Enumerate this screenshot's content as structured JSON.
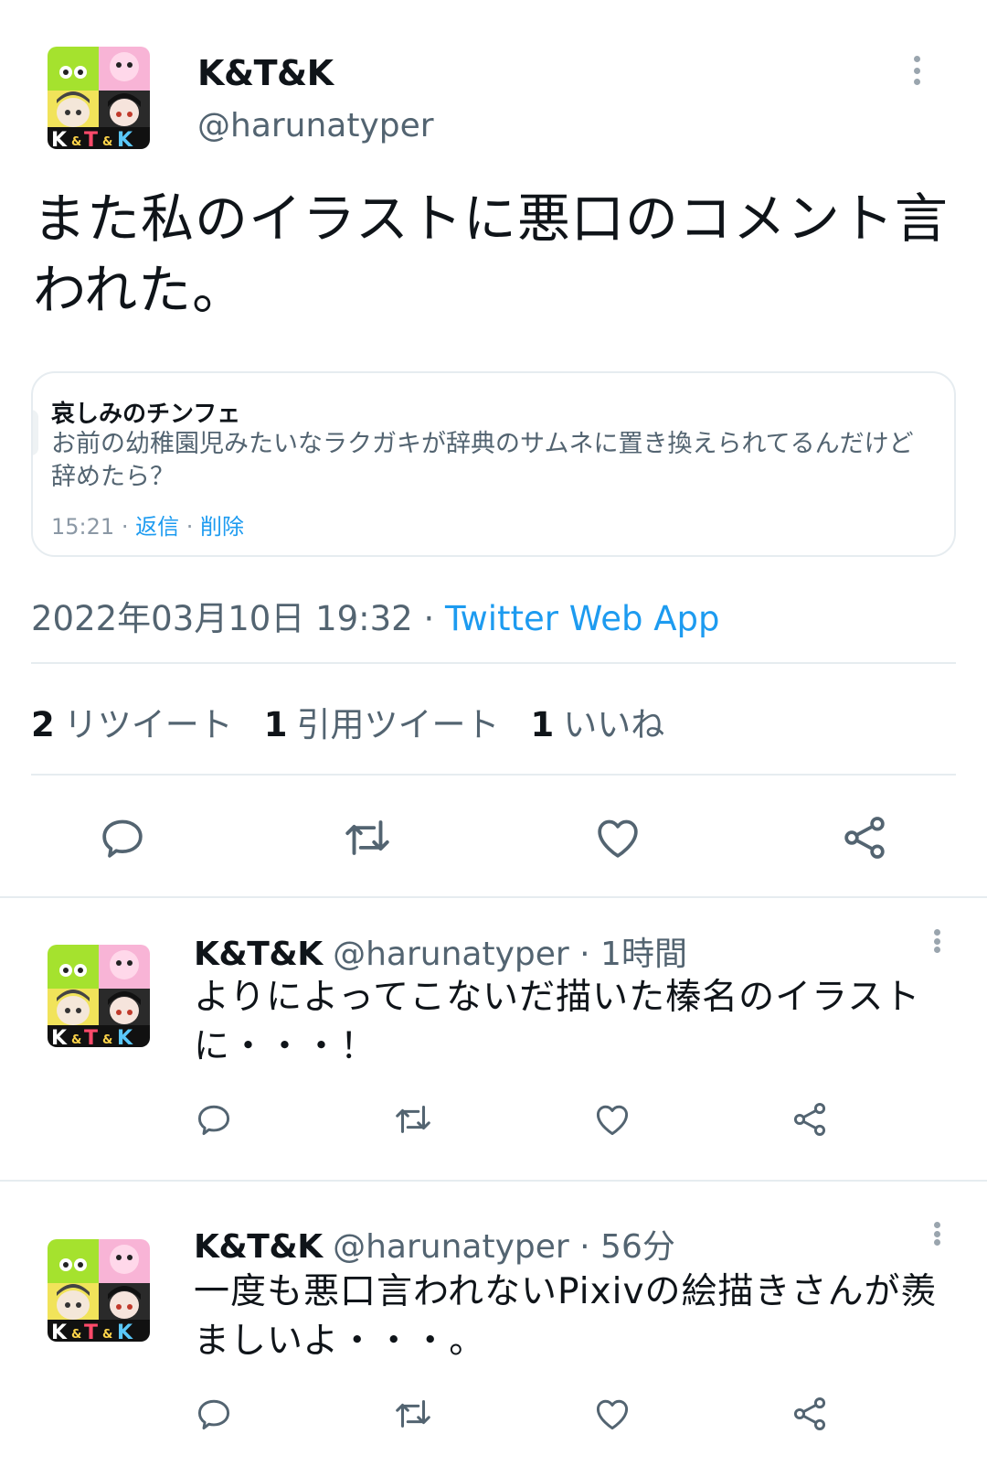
{
  "main_tweet": {
    "author_name": "K&T&K",
    "author_handle": "@harunatyper",
    "text": "また私のイラストに悪口のコメント言われた。",
    "embed": {
      "author": "哀しみのチンフェ",
      "body_line1": "お前の幼稚園児みたいなラクガキが辞典のサムネに置き換えられてるんだけど",
      "body_line2": "辞めたら？",
      "time": "15:21",
      "sep1": "·",
      "reply_link": "返信",
      "sep2": "·",
      "delete_link": "削除"
    },
    "timestamp": "2022年03月10日 19:32",
    "sep": "·",
    "source": "Twitter Web App",
    "stats": {
      "retweets_count": "2",
      "retweets_label": "リツイート",
      "quotes_count": "1",
      "quotes_label": "引用ツイート",
      "likes_count": "1",
      "likes_label": "いいね"
    }
  },
  "replies": [
    {
      "author_name": "K&T&K",
      "author_handle": "@harunatyper",
      "sep": "·",
      "time": "1時間",
      "text": "よりによってこないだ描いた榛名のイラストに・・・！"
    },
    {
      "author_name": "K&T&K",
      "author_handle": "@harunatyper",
      "sep": "·",
      "time": "56分",
      "text": "一度も悪口言われないPixivの絵描きさんが羨ましいよ・・・。"
    }
  ],
  "avatar_text": {
    "k1": "K",
    "amp1": "&",
    "t": "T",
    "amp2": "&",
    "k2": "K"
  },
  "icons": {
    "reply": "reply-icon",
    "retweet": "retweet-icon",
    "like": "like-icon",
    "share": "share-icon",
    "more": "more-icon"
  },
  "colors": {
    "link": "#1d9bf0",
    "secondary_text": "#536471",
    "icon": "#536471",
    "divider": "#e6ecf0"
  }
}
